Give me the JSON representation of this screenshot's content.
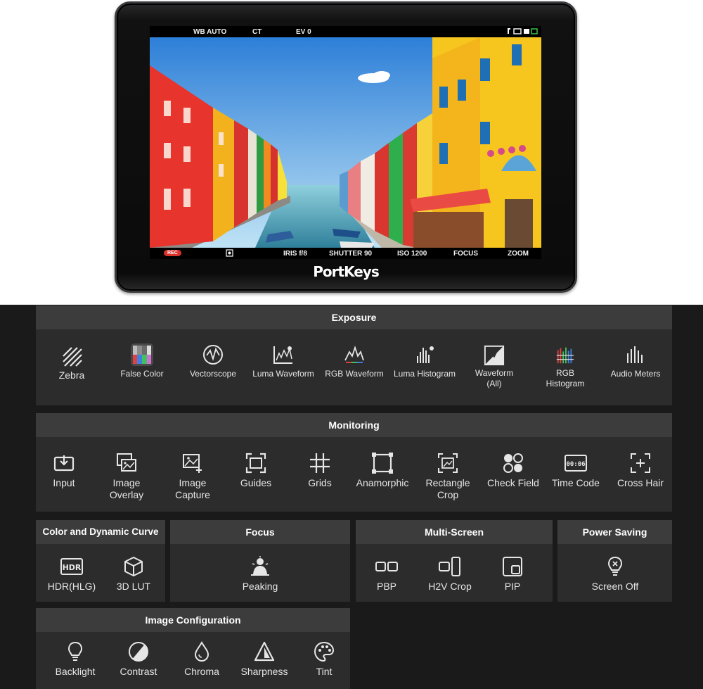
{
  "monitor": {
    "osd_top": {
      "wb": "WB AUTO",
      "ct": "CT",
      "ev": "EV 0"
    },
    "osd_bottom": {
      "rec": "REC",
      "iris": "IRIS f/8",
      "shutter": "SHUTTER 90",
      "iso": "ISO 1200",
      "focus": "FOCUS",
      "zoom": "ZOOM"
    },
    "brand": "PortKeys"
  },
  "exposure": {
    "title": "Exposure",
    "items": [
      {
        "label": "Zebra",
        "icon": "zebra-icon"
      },
      {
        "label": "False Color",
        "icon": "false-color-icon"
      },
      {
        "label": "Vectorscope",
        "icon": "vectorscope-icon"
      },
      {
        "label": "Luma Waveform",
        "icon": "luma-waveform-icon"
      },
      {
        "label": "RGB Waveform",
        "icon": "rgb-waveform-icon"
      },
      {
        "label": "Luma Histogram",
        "icon": "luma-histogram-icon"
      },
      {
        "label": "Waveform",
        "label2": "(All)",
        "icon": "waveform-all-icon"
      },
      {
        "label": "RGB",
        "label2": "Histogram",
        "icon": "rgb-histogram-icon"
      },
      {
        "label": "Audio Meters",
        "icon": "audio-meters-icon"
      }
    ]
  },
  "monitoring": {
    "title": "Monitoring",
    "items": [
      {
        "label": "Input",
        "icon": "input-icon"
      },
      {
        "label": "Image",
        "label2": "Overlay",
        "icon": "image-overlay-icon"
      },
      {
        "label": "Image",
        "label2": "Capture",
        "icon": "image-capture-icon"
      },
      {
        "label": "Guides",
        "icon": "guides-icon"
      },
      {
        "label": "Grids",
        "icon": "grids-icon"
      },
      {
        "label": "Anamorphic",
        "icon": "anamorphic-icon"
      },
      {
        "label": "Rectangle",
        "label2": "Crop",
        "icon": "rectangle-crop-icon"
      },
      {
        "label": "Check Field",
        "icon": "check-field-icon"
      },
      {
        "label": "Time Code",
        "icon": "time-code-icon"
      },
      {
        "label": "Cross Hair",
        "icon": "cross-hair-icon"
      }
    ]
  },
  "color_curve": {
    "title": "Color and Dynamic Curve",
    "items": [
      {
        "label": "HDR(HLG)",
        "icon": "hdr-icon",
        "icon_text": "HDR"
      },
      {
        "label": "3D LUT",
        "icon": "cube-icon"
      }
    ]
  },
  "focus": {
    "title": "Focus",
    "items": [
      {
        "label": "Peaking",
        "icon": "peaking-icon"
      }
    ]
  },
  "multiscreen": {
    "title": "Multi-Screen",
    "items": [
      {
        "label": "PBP",
        "icon": "pbp-icon"
      },
      {
        "label": "H2V Crop",
        "icon": "h2v-crop-icon"
      },
      {
        "label": "PIP",
        "icon": "pip-icon"
      }
    ]
  },
  "power": {
    "title": "Power Saving",
    "items": [
      {
        "label": "Screen Off",
        "icon": "screen-off-icon"
      }
    ]
  },
  "image_config": {
    "title": "Image Configuration",
    "items": [
      {
        "label": "Backlight",
        "icon": "backlight-icon"
      },
      {
        "label": "Contrast",
        "icon": "contrast-icon"
      },
      {
        "label": "Chroma",
        "icon": "chroma-icon"
      },
      {
        "label": "Sharpness",
        "icon": "sharpness-icon"
      },
      {
        "label": "Tint",
        "icon": "tint-icon"
      }
    ]
  },
  "time_code_icon_text": "00:06"
}
